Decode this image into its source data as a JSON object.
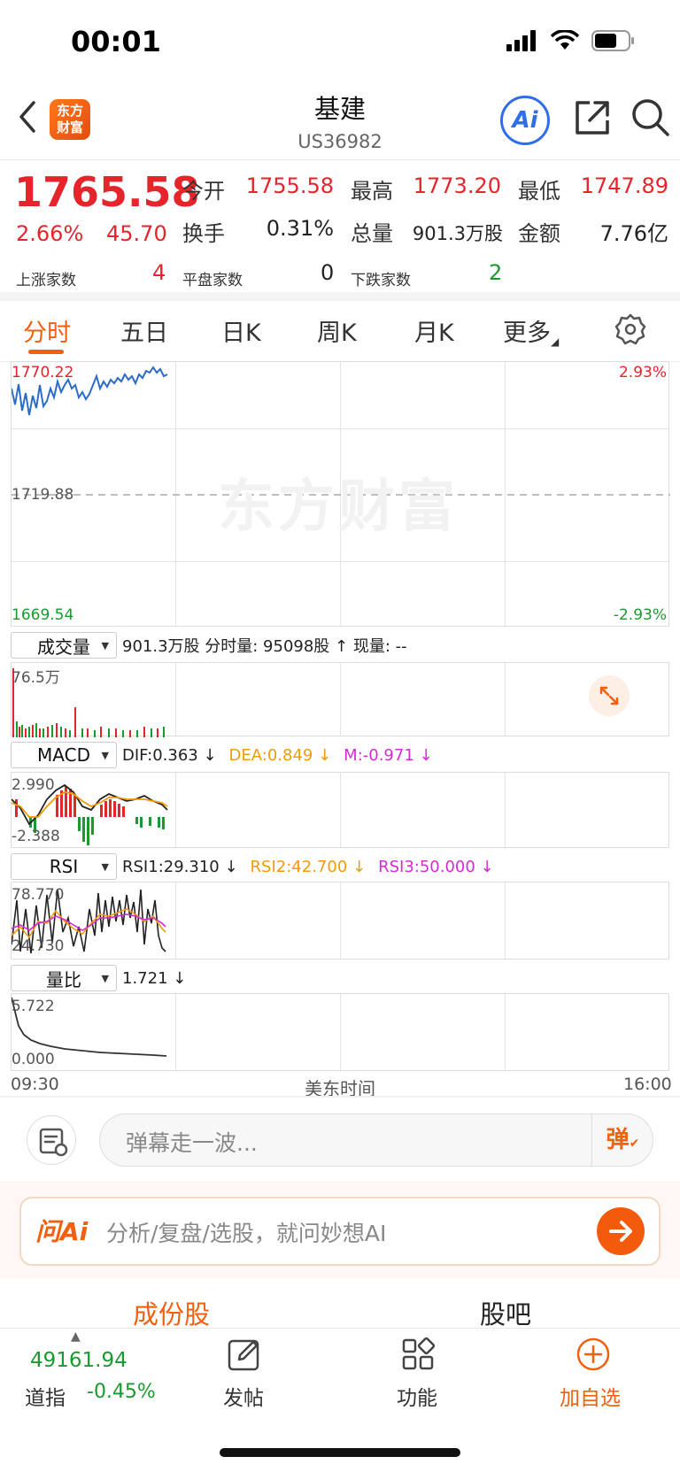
{
  "status": {
    "time": "00:01"
  },
  "header": {
    "logo_line1": "东方",
    "logo_line2": "财富",
    "title": "基建",
    "code": "US36982",
    "ai_label": "Ai"
  },
  "quote": {
    "price": "1765.58",
    "change_pct": "2.66%",
    "change": "45.70",
    "open_label": "今开",
    "open": "1755.58",
    "high_label": "最高",
    "high": "1773.20",
    "low_label": "最低",
    "low": "1747.89",
    "turnover_label": "换手",
    "turnover": "0.31%",
    "volume_label": "总量",
    "volume": "901.3万股",
    "amount_label": "金额",
    "amount": "7.76亿",
    "up_label": "上涨家数",
    "up_count": "4",
    "flat_label": "平盘家数",
    "flat_count": "0",
    "down_label": "下跌家数",
    "down_count": "2"
  },
  "tabs": [
    "分时",
    "五日",
    "日K",
    "周K",
    "月K",
    "更多"
  ],
  "chart": {
    "top_left": "1770.22",
    "mid_left": "1719.88",
    "bottom_left": "1669.54",
    "top_right": "2.93%",
    "bottom_right": "-2.93%",
    "watermark": "东方财富"
  },
  "volume_panel": {
    "selector": "成交量",
    "info": "901.3万股 分时量: 95098股 ↑ 现量: --",
    "max_label": "76.5万"
  },
  "macd_panel": {
    "selector": "MACD",
    "dif": "DIF:0.363 ↓",
    "dea": "DEA:0.849 ↓",
    "m": "M:-0.971 ↓",
    "top_label": "2.990",
    "bottom_label": "-2.388"
  },
  "rsi_panel": {
    "selector": "RSI",
    "rsi1": "RSI1:29.310 ↓",
    "rsi2": "RSI2:42.700 ↓",
    "rsi3": "RSI3:50.000 ↓",
    "top_label": "78.770",
    "bottom_label": "24.730"
  },
  "ratio_panel": {
    "selector": "量比",
    "value": "1.721 ↓",
    "top_label": "5.722",
    "bottom_label": "0.000"
  },
  "time_axis": {
    "start": "09:30",
    "middle": "美东时间",
    "end": "16:00"
  },
  "danmu": {
    "placeholder": "弹幕走一波...",
    "button": "弹"
  },
  "ask": {
    "logo": "问Ai",
    "placeholder": "分析/复盘/选股，就问妙想AI"
  },
  "subtabs": [
    "成份股",
    "股吧"
  ],
  "bottom_nav": {
    "index_value": "49161.94",
    "index_name": "道指",
    "index_change": "-0.45%",
    "post": "发帖",
    "functions": "功能",
    "add": "加自选"
  },
  "colors": {
    "up": "#e5242b",
    "down": "#1a9a2e",
    "accent": "#f0600e",
    "ai_blue": "#2f6ee8",
    "price_line": "#2b6cc4"
  }
}
